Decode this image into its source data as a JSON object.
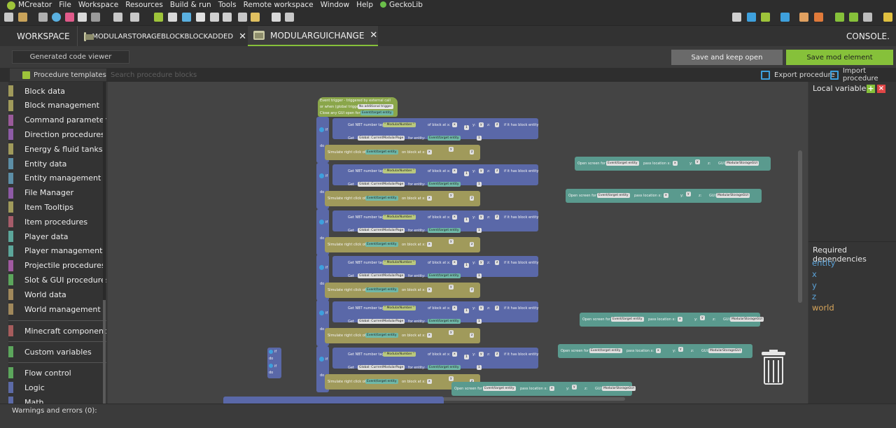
{
  "menu": [
    "MCreator",
    "File",
    "Workspace",
    "Resources",
    "Build & run",
    "Tools",
    "Remote workspace",
    "Window",
    "Help",
    "GeckoLib"
  ],
  "tabs": {
    "workspace": "WORKSPACE",
    "tab1": "MODULARSTORAGEBLOCKBLOCKADDED",
    "tab2": "MODULARGUICHANGE",
    "console": "CONSOLE"
  },
  "actions": {
    "code_viewer": "Generated code viewer",
    "save_keep_open": "Save and keep open",
    "save_mod_element": "Save mod element"
  },
  "toolbar2": {
    "templates": "Procedure templates",
    "search_placeholder": "Search procedure blocks",
    "export": "Export procedure",
    "import": "Import procedure"
  },
  "categories": [
    {
      "label": "Block data",
      "color": "#a09a5b"
    },
    {
      "label": "Block management",
      "color": "#a09a5b"
    },
    {
      "label": "Command parameters",
      "color": "#9a5a9a"
    },
    {
      "label": "Direction procedures",
      "color": "#8d5ba6"
    },
    {
      "label": "Energy & fluid tanks",
      "color": "#a09a5b"
    },
    {
      "label": "Entity data",
      "color": "#5c8ea6"
    },
    {
      "label": "Entity management",
      "color": "#5c8ea6"
    },
    {
      "label": "File Manager",
      "color": "#8e5aa6"
    },
    {
      "label": "Item Tooltips",
      "color": "#a09a5b"
    },
    {
      "label": "Item procedures",
      "color": "#a65c6a"
    },
    {
      "label": "Player data",
      "color": "#5ca69a"
    },
    {
      "label": "Player management",
      "color": "#5ca69a"
    },
    {
      "label": "Projectile procedures",
      "color": "#a05aa0"
    },
    {
      "label": "Slot & GUI procedures",
      "color": "#5ca65c"
    },
    {
      "label": "World data",
      "color": "#a0885b"
    },
    {
      "label": "World management",
      "color": "#a0885b"
    }
  ],
  "categories2": [
    {
      "label": "Minecraft components",
      "color": "#a65c5c"
    },
    {
      "label": "Custom variables",
      "color": "#5ca65c"
    },
    {
      "label": "Flow control",
      "color": "#5ca65c"
    },
    {
      "label": "Logic",
      "color": "#5c6aa6"
    },
    {
      "label": "Math",
      "color": "#5c6aa6"
    }
  ],
  "blocks": {
    "event_trigger": "Event trigger - triggered by external call",
    "or_when": "or when (global trigger):",
    "no_trigger": "No additional trigger",
    "close_gui": "Close any GUI open for",
    "entity": "Event/target entity",
    "if": "if",
    "do": "do",
    "get_nbt": "Get NBT number tag",
    "nbt_name": "ModularNumber",
    "of_block": "of block at x:",
    "if_has": "if it has block entity",
    "get_global": "Get",
    "global_var": "Global: CurrentModularPage",
    "for_entity": "for entity:",
    "simulate": "Simulate right click of",
    "on_block": "on block at x:",
    "open_screen": "Open screen for",
    "pass_loc": "pass location x:",
    "gui": "GUI:",
    "gui_name": "ModularStorageGUI",
    "y": "y:",
    "z": "z:",
    "num1": "1",
    "x": "x",
    "yv": "y",
    "zv": "z"
  },
  "right_panel": {
    "local_vars": "Local variables",
    "add": "+",
    "remove": "×",
    "required": "Required dependencies",
    "deps": [
      {
        "name": "entity",
        "color": "#5ba3d9"
      },
      {
        "name": "x",
        "color": "#5ba3d9"
      },
      {
        "name": "y",
        "color": "#5ba3d9"
      },
      {
        "name": "z",
        "color": "#5ba3d9"
      },
      {
        "name": "world",
        "color": "#d9a65b"
      }
    ]
  },
  "status": {
    "warnings": "Warnings and errors (0):"
  }
}
